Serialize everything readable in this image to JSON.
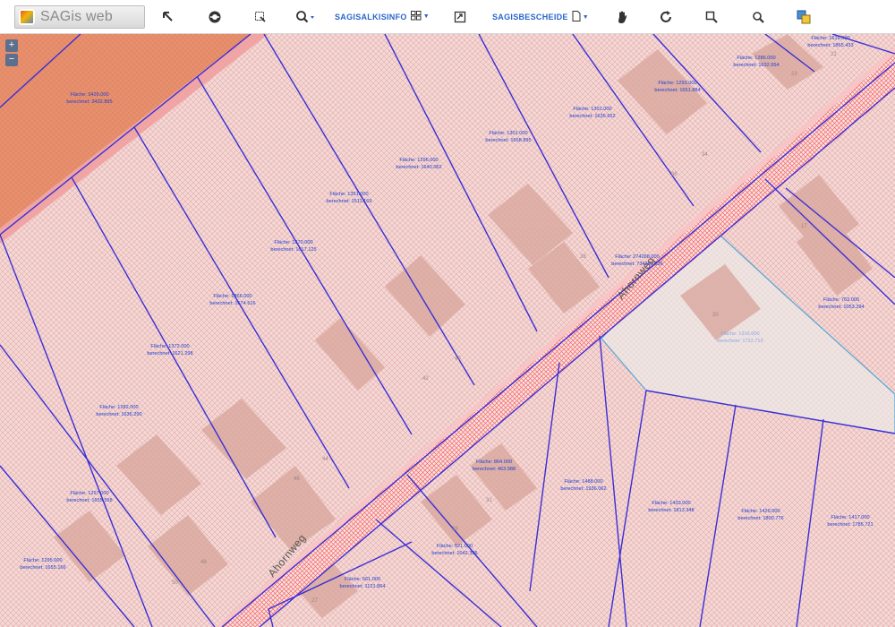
{
  "app": {
    "logo_text": "SAGis web"
  },
  "toolbar": {
    "alkis_label": "SAGISALKISINFO",
    "bescheide_label": "SAGISBESCHEIDE",
    "buttons": [
      {
        "name": "select-arrow-icon"
      },
      {
        "name": "info-circle-icon"
      },
      {
        "name": "select-rect-icon"
      },
      {
        "name": "zoom-menu-icon"
      },
      {
        "name": "export-icon"
      },
      {
        "name": "pan-hand-icon"
      },
      {
        "name": "refresh-icon"
      },
      {
        "name": "zoom-in-icon"
      },
      {
        "name": "zoom-out-icon"
      },
      {
        "name": "layers-icon"
      }
    ]
  },
  "map": {
    "street_name": "Ahornweg",
    "zoom_in_label": "+",
    "zoom_out_label": "−",
    "colors": {
      "parcel_fill": "#f3d9d6",
      "hatch": "#e7a9a9",
      "parcel_border": "#3a2fd6",
      "highlight_fill": "#efe4e2",
      "highlight_border": "#55a6d6",
      "street_hatch": "#f06868",
      "building": "#d9a89e",
      "orange_area": "#e8906e"
    },
    "parcels": [
      {
        "id": "p1",
        "line1": "Fläche: 3426.000",
        "line2": "berechnet: 3432.895"
      },
      {
        "id": "p2",
        "line1": "Fläche: 1296.000",
        "line2": "berechnet: 1640.062"
      },
      {
        "id": "p3",
        "line1": "Fläche: 1351.000",
        "line2": "berechnet: 1511.169"
      },
      {
        "id": "p4",
        "line1": "Fläche: 1370.000",
        "line2": "berechnet: 1617.125"
      },
      {
        "id": "p5",
        "line1": "Fläche: 1366.000",
        "line2": "berechnet: 1674.616"
      },
      {
        "id": "p6",
        "line1": "Fläche: 1372.000",
        "line2": "berechnet: 1621.298"
      },
      {
        "id": "p7",
        "line1": "Fläche: 1282.000",
        "line2": "berechnet: 1636.290"
      },
      {
        "id": "p8",
        "line1": "Fläche: 1297.000",
        "line2": "berechnet: 1655.558"
      },
      {
        "id": "p9",
        "line1": "Fläche: 1295.000",
        "line2": "berechnet: 1655.166"
      },
      {
        "id": "p10",
        "line1": "Fläche: 1301.000",
        "line2": "berechnet: 1658.895"
      },
      {
        "id": "p11",
        "line1": "Fläche: 1301.000",
        "line2": "berechnet: 1635.652"
      },
      {
        "id": "p12",
        "line1": "Fläche: 1293.000",
        "line2": "berechnet: 1651.884"
      },
      {
        "id": "p13",
        "line1": "Fläche: 1286.000",
        "line2": "berechnet: 1632.654"
      },
      {
        "id": "p14",
        "line1": "Fläche: 1619.000",
        "line2": "berechnet: 1865.433"
      },
      {
        "id": "p15",
        "line1": "Fläche: 274268.000",
        "line2": "berechnet: 734282.836"
      },
      {
        "id": "p16",
        "line1": "Fläche: 763.000",
        "line2": "berechnet: 1053.294"
      },
      {
        "id": "p17",
        "line1": "Fläche: 1316.000",
        "line2": "berechnet: 1722.713"
      },
      {
        "id": "p18",
        "line1": "Fläche: 864.000",
        "line2": "berechnet: 463.988"
      },
      {
        "id": "p19",
        "line1": "Fläche: 1488.000",
        "line2": "berechnet: 1936.062"
      },
      {
        "id": "p20",
        "line1": "Fläche: 1433.000",
        "line2": "berechnet: 1813.348"
      },
      {
        "id": "p21",
        "line1": "Fläche: 1429.000",
        "line2": "berechnet: 1800.776"
      },
      {
        "id": "p22",
        "line1": "Fläche: 1417.000",
        "line2": "berechnet: 1785.721"
      },
      {
        "id": "p23",
        "line1": "Fläche: 521.000",
        "line2": "berechnet: 1042.396"
      },
      {
        "id": "p24",
        "line1": "Fläche: 561.000",
        "line2": "berechnet: 1121.864"
      }
    ],
    "house_numbers": [
      {
        "id": "h1",
        "text": "34"
      },
      {
        "id": "h2",
        "text": "36"
      },
      {
        "id": "h3",
        "text": "38"
      },
      {
        "id": "h4",
        "text": "40"
      },
      {
        "id": "h5",
        "text": "42"
      },
      {
        "id": "h6",
        "text": "44"
      },
      {
        "id": "h7",
        "text": "46"
      },
      {
        "id": "h8",
        "text": "48"
      },
      {
        "id": "h9",
        "text": "50"
      },
      {
        "id": "h10",
        "text": "31"
      },
      {
        "id": "h11",
        "text": "29"
      },
      {
        "id": "h12",
        "text": "27"
      },
      {
        "id": "h13",
        "text": "17"
      },
      {
        "id": "h14",
        "text": "20"
      },
      {
        "id": "h15",
        "text": "21"
      },
      {
        "id": "h16",
        "text": "23"
      }
    ]
  }
}
